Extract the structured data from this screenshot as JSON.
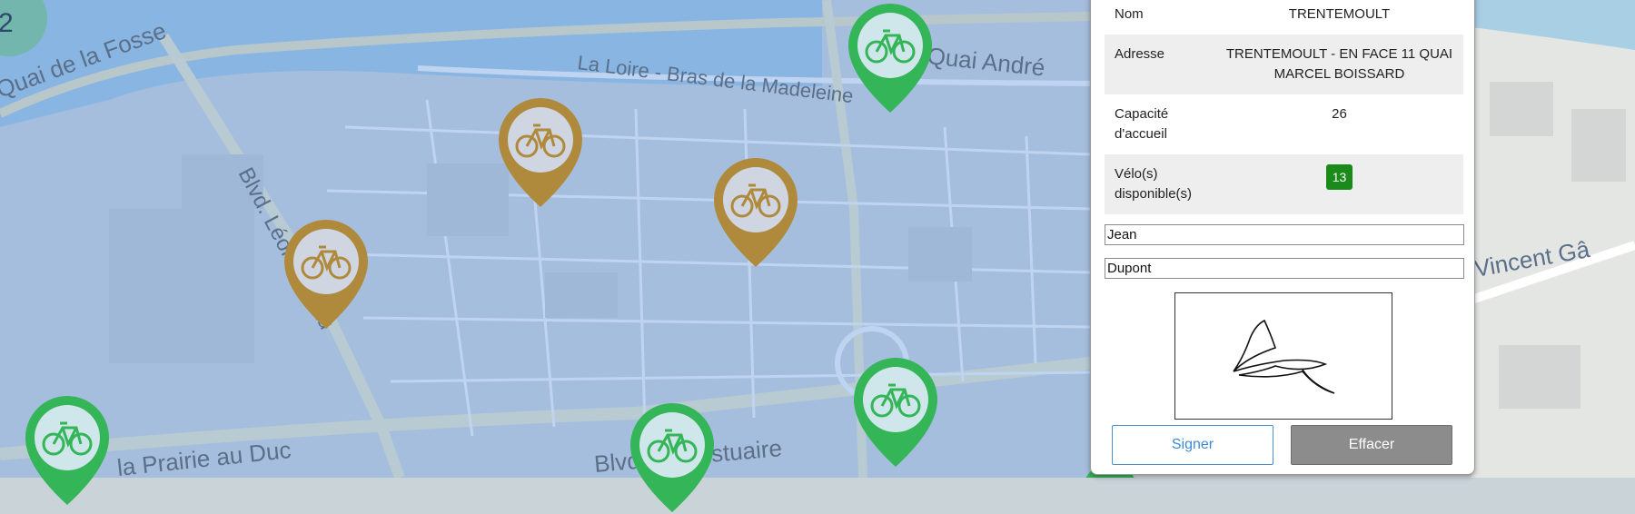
{
  "map": {
    "street_labels": [
      "Quai de la Fosse",
      "La Loire - Bras de la Madeleine",
      "Quai André",
      "Blvd. Léon Bureau",
      "la Prairie au Duc",
      "Blvd. de l'Estuaire",
      "Vincent Gâ"
    ],
    "cluster_count": "2"
  },
  "station": {
    "name_label": "Nom",
    "name_value": "TRENTEMOULT",
    "address_label": "Adresse",
    "address_value": "TRENTEMOULT - EN FACE 11 QUAI MARCEL BOISSARD",
    "capacity_label": "Capacité d'accueil",
    "capacity_value": "26",
    "bikes_label": "Vélo(s) disponible(s)",
    "bikes_value": "13"
  },
  "form": {
    "first_name": "Jean",
    "last_name": "Dupont",
    "sign_button": "Signer",
    "clear_button": "Effacer"
  },
  "colors": {
    "pin_green": "#34b558",
    "pin_gold": "#b08a3c",
    "badge_green": "#1a8a1a"
  }
}
